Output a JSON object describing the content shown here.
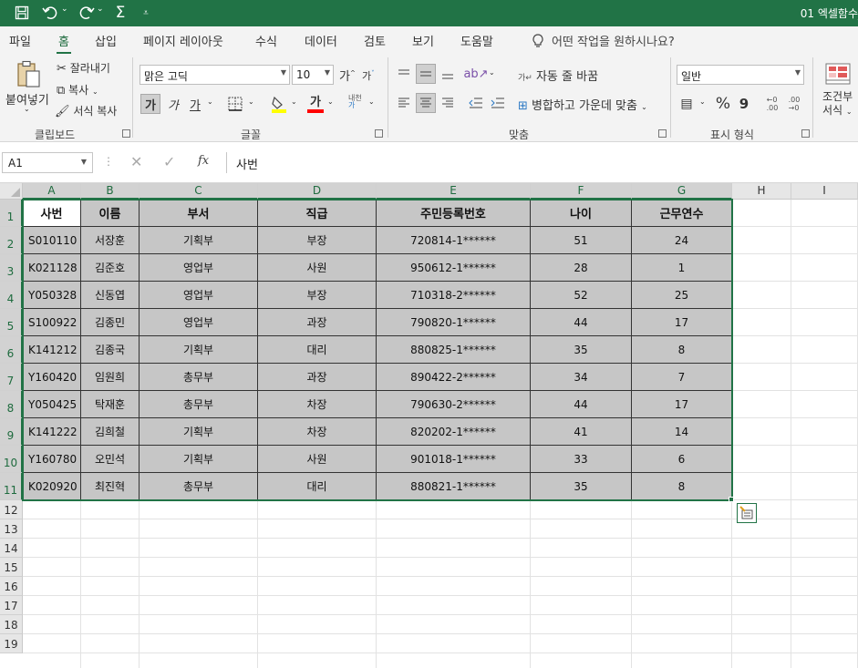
{
  "titlebar": {
    "title": "01 엑셀함수_"
  },
  "menu": {
    "tabs": [
      "파일",
      "홈",
      "삽입",
      "페이지 레이아웃",
      "수식",
      "데이터",
      "검토",
      "보기",
      "도움말"
    ],
    "active_index": 1,
    "tell_me": "어떤 작업을 원하시나요?"
  },
  "ribbon": {
    "clipboard": {
      "paste": "붙여넣기",
      "cut": "잘라내기",
      "copy": "복사",
      "format_painter": "서식 복사",
      "group": "클립보드"
    },
    "font": {
      "name": "맑은 고딕",
      "size": "10",
      "bold": "가",
      "italic": "가",
      "underline": "가",
      "color_glyph": "가",
      "phonetic": "내천",
      "grow": "가",
      "shrink": "가",
      "group": "글꼴",
      "highlight_color": "#ffff00",
      "font_color": "#ff0000"
    },
    "alignment": {
      "wrap": "자동 줄 바꿈",
      "merge": "병합하고 가운데 맞춤",
      "group": "맞춤"
    },
    "number": {
      "format": "일반",
      "percent": "%",
      "comma": "9",
      "group": "표시 형식"
    },
    "styles": {
      "conditional_line1": "조건부",
      "conditional_line2": "서식"
    }
  },
  "formula_bar": {
    "name_box": "A1",
    "content": "사번"
  },
  "columns": [
    "A",
    "B",
    "C",
    "D",
    "E",
    "F",
    "G",
    "H",
    "I"
  ],
  "rows": [
    "1",
    "2",
    "3",
    "4",
    "5",
    "6",
    "7",
    "8",
    "9",
    "10",
    "11",
    "12",
    "13",
    "14",
    "15",
    "16",
    "17",
    "18",
    "19"
  ],
  "table": {
    "headers": [
      "사번",
      "이름",
      "부서",
      "직급",
      "주민등록번호",
      "나이",
      "근무연수"
    ],
    "rows": [
      [
        "S010110",
        "서장훈",
        "기획부",
        "부장",
        "720814-1******",
        "51",
        "24"
      ],
      [
        "K021128",
        "김준호",
        "영업부",
        "사원",
        "950612-1******",
        "28",
        "1"
      ],
      [
        "Y050328",
        "신동엽",
        "영업부",
        "부장",
        "710318-2******",
        "52",
        "25"
      ],
      [
        "S100922",
        "김종민",
        "영업부",
        "과장",
        "790820-1******",
        "44",
        "17"
      ],
      [
        "K141212",
        "김종국",
        "기획부",
        "대리",
        "880825-1******",
        "35",
        "8"
      ],
      [
        "Y160420",
        "임원희",
        "총무부",
        "과장",
        "890422-2******",
        "34",
        "7"
      ],
      [
        "Y050425",
        "탁재훈",
        "총무부",
        "차장",
        "790630-2******",
        "44",
        "17"
      ],
      [
        "K141222",
        "김희철",
        "기획부",
        "차장",
        "820202-1******",
        "41",
        "14"
      ],
      [
        "Y160780",
        "오민석",
        "기획부",
        "사원",
        "901018-1******",
        "33",
        "6"
      ],
      [
        "K020920",
        "최진혁",
        "총무부",
        "대리",
        "880821-1******",
        "35",
        "8"
      ]
    ]
  },
  "colors": {
    "accent": "#217346",
    "selection_fill": "#c6c6c6"
  }
}
